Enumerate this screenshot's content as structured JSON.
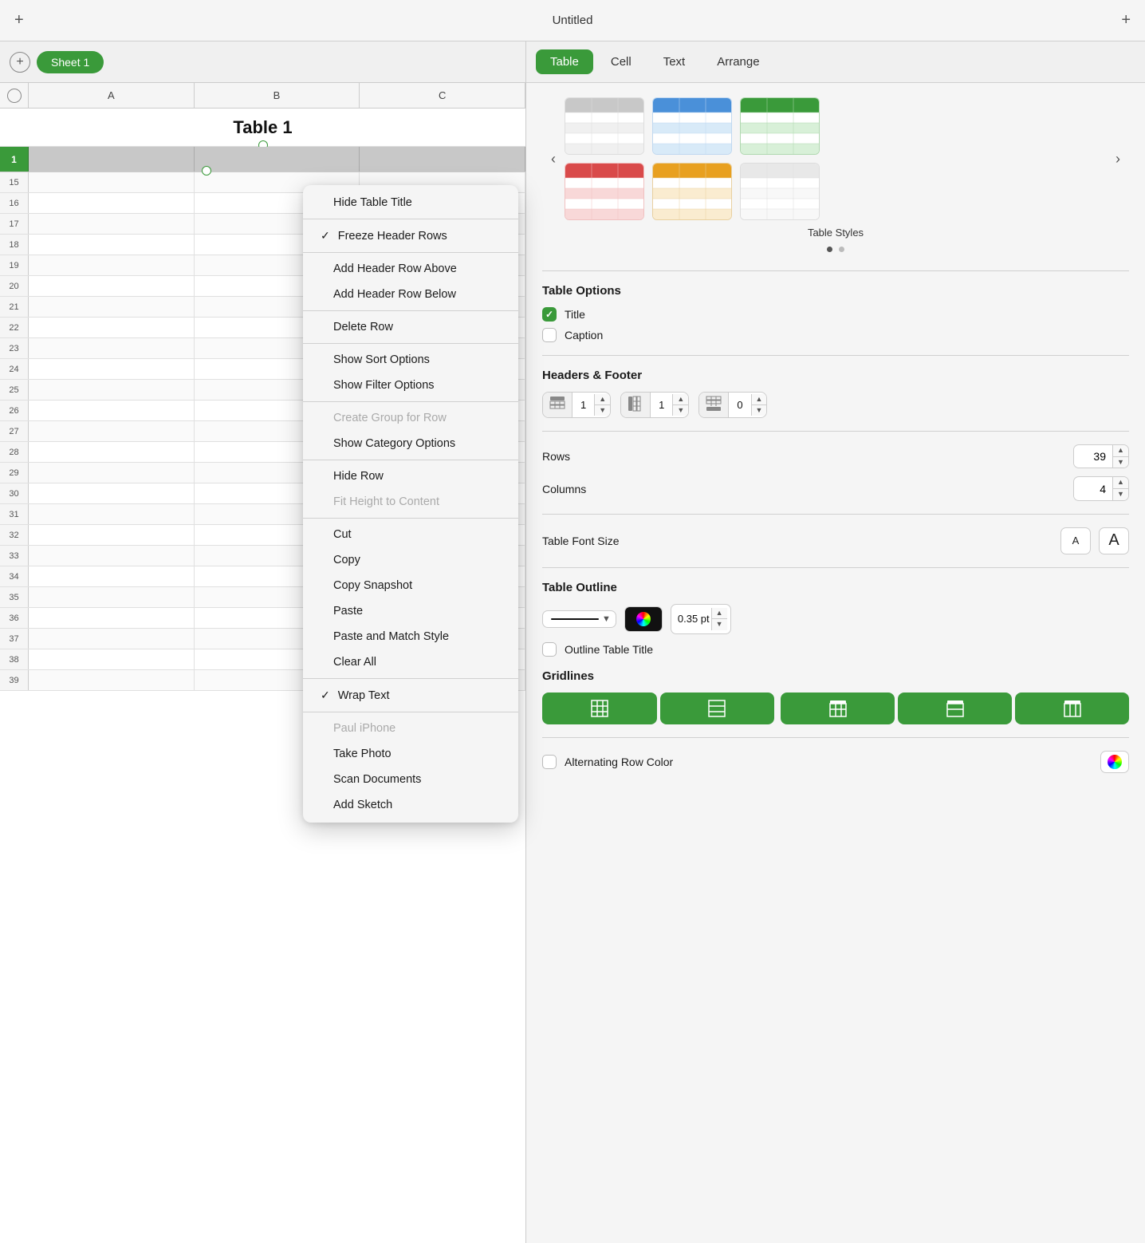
{
  "titleBar": {
    "title": "Untitled",
    "addLabel": "+",
    "plusLabel": "+"
  },
  "sheetTab": {
    "addLabel": "+",
    "tabLabel": "Sheet 1"
  },
  "colHeaders": [
    "A",
    "B",
    "C"
  ],
  "tableTitle": "Table 1",
  "rowNumbers": [
    15,
    16,
    17,
    18,
    19,
    20,
    21,
    22,
    23,
    24,
    25,
    26,
    27,
    28,
    29,
    30,
    31,
    32,
    33,
    34,
    35,
    36,
    37,
    38,
    39
  ],
  "contextMenu": {
    "items": [
      {
        "id": "hide-table-title",
        "label": "Hide Table Title",
        "checked": false,
        "disabled": false,
        "separator_after": true
      },
      {
        "id": "freeze-header-rows",
        "label": "Freeze Header Rows",
        "checked": true,
        "disabled": false,
        "separator_after": true
      },
      {
        "id": "add-header-row-above",
        "label": "Add Header Row Above",
        "checked": false,
        "disabled": false,
        "separator_after": false
      },
      {
        "id": "add-header-row-below",
        "label": "Add Header Row Below",
        "checked": false,
        "disabled": false,
        "separator_after": true
      },
      {
        "id": "delete-row",
        "label": "Delete Row",
        "checked": false,
        "disabled": false,
        "separator_after": true
      },
      {
        "id": "show-sort-options",
        "label": "Show Sort Options",
        "checked": false,
        "disabled": false,
        "separator_after": false
      },
      {
        "id": "show-filter-options",
        "label": "Show Filter Options",
        "checked": false,
        "disabled": false,
        "separator_after": true
      },
      {
        "id": "create-group-for-row",
        "label": "Create Group for Row",
        "checked": false,
        "disabled": true,
        "separator_after": false
      },
      {
        "id": "show-category-options",
        "label": "Show Category Options",
        "checked": false,
        "disabled": false,
        "separator_after": true
      },
      {
        "id": "hide-row",
        "label": "Hide Row",
        "checked": false,
        "disabled": false,
        "separator_after": false
      },
      {
        "id": "fit-height-to-content",
        "label": "Fit Height to Content",
        "checked": false,
        "disabled": true,
        "separator_after": true
      },
      {
        "id": "cut",
        "label": "Cut",
        "checked": false,
        "disabled": false,
        "separator_after": false
      },
      {
        "id": "copy",
        "label": "Copy",
        "checked": false,
        "disabled": false,
        "separator_after": false
      },
      {
        "id": "copy-snapshot",
        "label": "Copy Snapshot",
        "checked": false,
        "disabled": false,
        "separator_after": false
      },
      {
        "id": "paste",
        "label": "Paste",
        "checked": false,
        "disabled": false,
        "separator_after": false
      },
      {
        "id": "paste-match-style",
        "label": "Paste and Match Style",
        "checked": false,
        "disabled": false,
        "separator_after": false
      },
      {
        "id": "clear-all",
        "label": "Clear All",
        "checked": false,
        "disabled": false,
        "separator_after": true
      },
      {
        "id": "wrap-text",
        "label": "Wrap Text",
        "checked": true,
        "disabled": false,
        "separator_after": true
      },
      {
        "id": "paul-iphone",
        "label": "Paul iPhone",
        "checked": false,
        "disabled": true,
        "separator_after": false
      },
      {
        "id": "take-photo",
        "label": "Take Photo",
        "checked": false,
        "disabled": false,
        "separator_after": false
      },
      {
        "id": "scan-documents",
        "label": "Scan Documents",
        "checked": false,
        "disabled": false,
        "separator_after": false
      },
      {
        "id": "add-sketch",
        "label": "Add Sketch",
        "checked": false,
        "disabled": false,
        "separator_after": false
      }
    ]
  },
  "rightPanel": {
    "tabs": [
      "Table",
      "Cell",
      "Text",
      "Arrange"
    ],
    "activeTab": "Table",
    "tableStyles": {
      "label": "Table Styles",
      "styles": [
        {
          "id": "plain",
          "headerColor": "#c8c8c8",
          "altColor": "#f0f0f0"
        },
        {
          "id": "blue",
          "headerColor": "#4a90d9",
          "altColor": "#d8eaf8"
        },
        {
          "id": "green",
          "headerColor": "#3a9a3a",
          "altColor": "#d8f0d8"
        },
        {
          "id": "red",
          "headerColor": "#d94a4a",
          "altColor": "#f8d8d8"
        },
        {
          "id": "orange",
          "headerColor": "#e8a020",
          "altColor": "#faecd0"
        },
        {
          "id": "minimal",
          "headerColor": "#e0e0e0",
          "altColor": "#f8f8f8"
        }
      ]
    },
    "tableOptions": {
      "label": "Table Options",
      "title": {
        "label": "Title",
        "checked": true
      },
      "caption": {
        "label": "Caption",
        "checked": false
      }
    },
    "headersFooter": {
      "label": "Headers & Footer",
      "headerRows": {
        "icon": "⊞",
        "value": "1"
      },
      "headerCols": {
        "icon": "⊞",
        "value": "1"
      },
      "footerRows": {
        "icon": "⊟",
        "value": "0"
      }
    },
    "rows": {
      "label": "Rows",
      "value": "39"
    },
    "columns": {
      "label": "Columns",
      "value": "4"
    },
    "tableFontSize": {
      "label": "Table Font Size",
      "smallLabel": "A",
      "largeLabel": "A"
    },
    "tableOutline": {
      "label": "Table Outline",
      "ptValue": "0.35 pt",
      "outlineTitleLabel": "Outline Table Title"
    },
    "gridlines": {
      "label": "Gridlines"
    },
    "alternatingRowColor": {
      "label": "Alternating Row Color",
      "checked": false
    }
  }
}
